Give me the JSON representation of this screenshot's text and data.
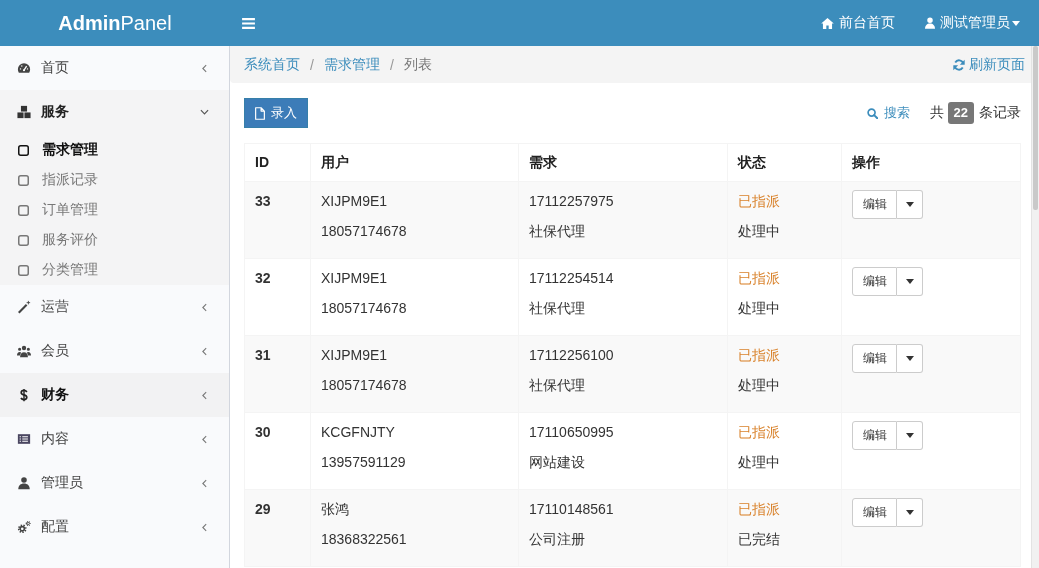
{
  "header": {
    "logo": "**Admin**Panel",
    "nav": [
      {
        "label": "前台首页",
        "dropdown": false
      },
      {
        "label": "测试管理员",
        "dropdown": true
      }
    ]
  },
  "sidebar": {
    "items": [
      {
        "label": "首页",
        "expanded": false,
        "hovered": false
      },
      {
        "label": "服务",
        "expanded": true,
        "hovered": false,
        "children": [
          {
            "label": "需求管理",
            "selected": true
          },
          {
            "label": "指派记录",
            "selected": false
          },
          {
            "label": "订单管理",
            "selected": false
          },
          {
            "label": "服务评价",
            "selected": false
          },
          {
            "label": "分类管理",
            "selected": false
          }
        ]
      },
      {
        "label": "运营",
        "expanded": false,
        "hovered": false
      },
      {
        "label": "会员",
        "expanded": false,
        "hovered": false
      },
      {
        "label": "财务",
        "expanded": false,
        "hovered": true
      },
      {
        "label": "内容",
        "expanded": false,
        "hovered": false
      },
      {
        "label": "管理员",
        "expanded": false,
        "hovered": false
      },
      {
        "label": "配置",
        "expanded": false,
        "hovered": false
      }
    ]
  },
  "breadcrumb": {
    "items": [
      {
        "label": "系统首页",
        "separator": "/"
      },
      {
        "label": "需求管理",
        "separator": "/"
      },
      {
        "label": "列表"
      }
    ],
    "refresh": "刷新页面"
  },
  "toolbar": {
    "add_button": "录入",
    "search": "搜索",
    "total_prefix": "共",
    "total_count": "22",
    "total_suffix": "条记录"
  },
  "table": {
    "columns": [
      "ID",
      "用户",
      "需求",
      "状态",
      "操作"
    ],
    "rows": [
      {
        "id": "33",
        "user": "XIJPM9E1",
        "phone": "18057174678",
        "order_no": "17112257975",
        "service": "社保代理",
        "assign": {
          "text": "已指派",
          "color": "#d9822b"
        },
        "progress": "处理中",
        "action": "编辑"
      },
      {
        "id": "32",
        "user": "XIJPM9E1",
        "phone": "18057174678",
        "order_no": "17112254514",
        "service": "社保代理",
        "assign": {
          "text": "已指派",
          "color": "#d9822b"
        },
        "progress": "处理中",
        "action": "编辑"
      },
      {
        "id": "31",
        "user": "XIJPM9E1",
        "phone": "18057174678",
        "order_no": "17112256100",
        "service": "社保代理",
        "assign": {
          "text": "已指派",
          "color": "#d9822b"
        },
        "progress": "处理中",
        "action": "编辑"
      },
      {
        "id": "30",
        "user": "KCGFNJTY",
        "phone": "13957591129",
        "order_no": "17110650995",
        "service": "网站建设",
        "assign": {
          "text": "已指派",
          "color": "#d9822b"
        },
        "progress": "处理中",
        "action": "编辑"
      },
      {
        "id": "29",
        "user": "张鸿",
        "phone": "18368322561",
        "order_no": "17110148561",
        "service": "公司注册",
        "assign": {
          "text": "已指派",
          "color": "#d9822b"
        },
        "progress": "已完结",
        "action": "编辑"
      }
    ]
  }
}
